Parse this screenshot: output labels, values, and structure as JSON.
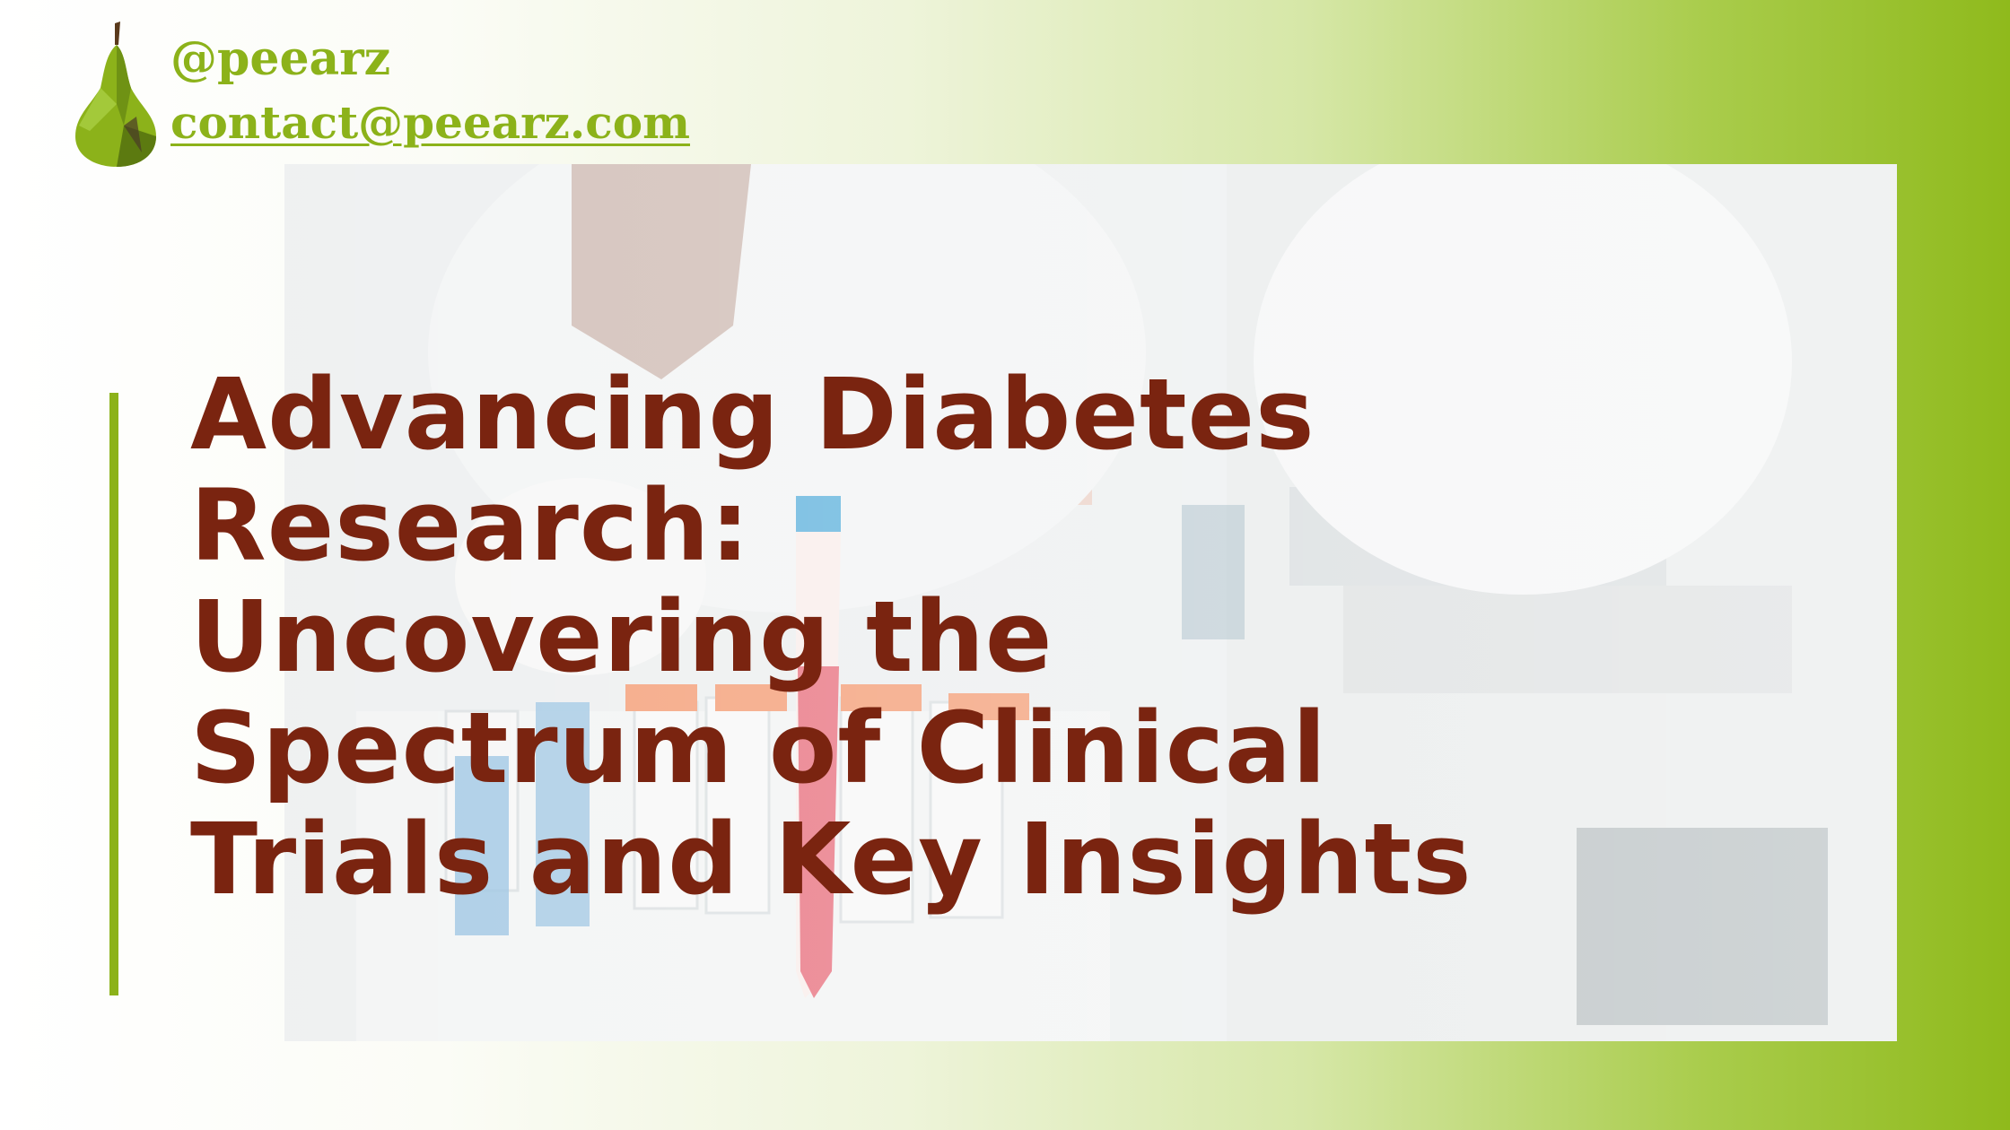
{
  "brand": {
    "handle": "@peearz",
    "email": "contact@peearz.com",
    "logo_icon": "pear-icon",
    "accent_color": "#8cb21a"
  },
  "headline": {
    "lines": [
      "Advancing Diabetes",
      "Research:",
      "Uncovering the",
      "Spectrum of Clinical",
      "Trials and Key Insights"
    ],
    "color": "#7a2410"
  },
  "photo": {
    "description_icon": "lab-test-tubes-photo"
  }
}
